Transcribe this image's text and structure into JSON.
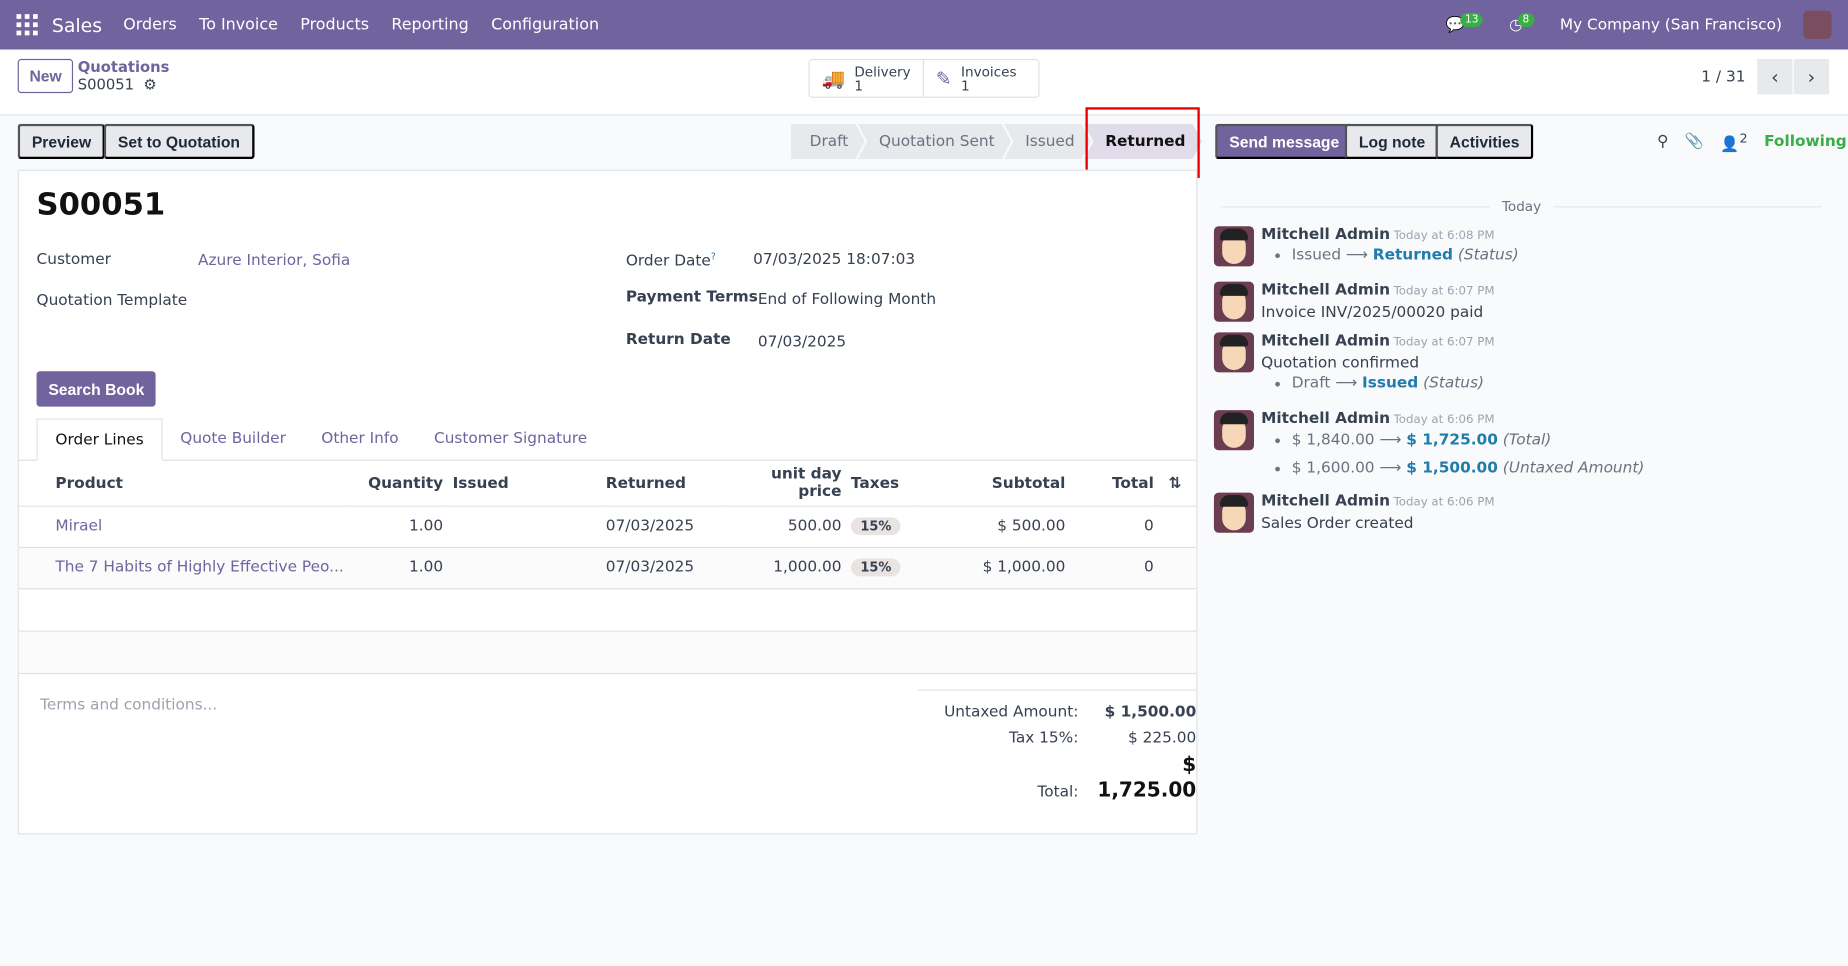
{
  "nav": {
    "app": "Sales",
    "menu": [
      "Orders",
      "To Invoice",
      "Products",
      "Reporting",
      "Configuration"
    ],
    "messages_count": "13",
    "activities_count": "8",
    "company": "My Company (San Francisco)"
  },
  "control": {
    "new": "New",
    "breadcrumb_parent": "Quotations",
    "breadcrumb_current": "S00051",
    "delivery_label": "Delivery",
    "delivery_count": "1",
    "invoices_label": "Invoices",
    "invoices_count": "1",
    "pager": "1 / 31"
  },
  "actions": {
    "preview": "Preview",
    "set_to_quotation": "Set to Quotation"
  },
  "statusbar": [
    "Draft",
    "Quotation Sent",
    "Issued",
    "Returned"
  ],
  "chatter_buttons": {
    "send": "Send message",
    "log": "Log note",
    "activities": "Activities",
    "followers_count": "2",
    "following": "Following"
  },
  "form": {
    "title": "S00051",
    "customer_label": "Customer",
    "customer": "Azure Interior, Sofia",
    "template_label": "Quotation Template",
    "order_date_label": "Order Date",
    "order_date_help": "?",
    "order_date": "07/03/2025 18:07:03",
    "payment_terms_label": "Payment Terms",
    "payment_terms": "End of Following Month",
    "return_date_label": "Return Date",
    "return_date": "07/03/2025",
    "search_book": "Search Book"
  },
  "tabs": [
    "Order Lines",
    "Quote Builder",
    "Other Info",
    "Customer Signature"
  ],
  "table": {
    "headers": [
      "Product",
      "Quantity",
      "Issued",
      "Returned",
      "unit day price",
      "Taxes",
      "Subtotal",
      "Total"
    ],
    "rows": [
      {
        "product": "Mirael",
        "quantity": "1.00",
        "issued": "",
        "returned": "07/03/2025",
        "price": "500.00",
        "tax": "15%",
        "subtotal": "$ 500.00",
        "total": "0"
      },
      {
        "product": "The 7 Habits of Highly Effective Peo...",
        "quantity": "1.00",
        "issued": "",
        "returned": "07/03/2025",
        "price": "1,000.00",
        "tax": "15%",
        "subtotal": "$ 1,000.00",
        "total": "0"
      }
    ]
  },
  "terms_placeholder": "Terms and conditions...",
  "totals": {
    "untaxed_label": "Untaxed Amount:",
    "untaxed": "$ 1,500.00",
    "tax_label": "Tax 15%:",
    "tax": "$ 225.00",
    "total_label": "Total:",
    "total": "$ 1,725.00"
  },
  "chatter": {
    "day": "Today",
    "messages": [
      {
        "author": "Mitchell Admin",
        "time": "Today at 6:08 PM",
        "old": "Issued",
        "new": "Returned",
        "field": "(Status)"
      },
      {
        "author": "Mitchell Admin",
        "time": "Today at 6:07 PM",
        "body": "Invoice INV/2025/00020 paid"
      },
      {
        "author": "Mitchell Admin",
        "time": "Today at 6:07 PM",
        "body": "Quotation confirmed",
        "old": "Draft",
        "new": "Issued",
        "field": "(Status)"
      },
      {
        "author": "Mitchell Admin",
        "time": "Today at 6:06 PM",
        "old": "$ 1,840.00",
        "new": "$ 1,725.00",
        "field": "(Total)",
        "old2": "$ 1,600.00",
        "new2": "$ 1,500.00",
        "field2": "(Untaxed Amount)"
      },
      {
        "author": "Mitchell Admin",
        "time": "Today at 6:06 PM",
        "body": "Sales Order created"
      }
    ]
  }
}
